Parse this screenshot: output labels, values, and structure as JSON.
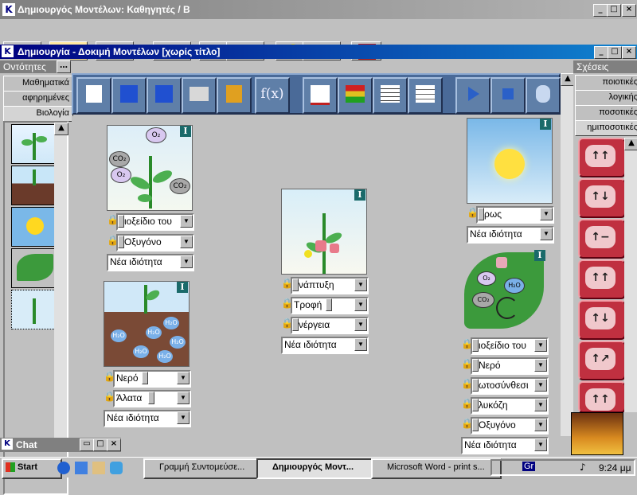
{
  "app": {
    "title": "Δημιουργός Μοντέλων:  Καθηγητές  /  Β"
  },
  "model_window": {
    "title": "Δημιουργία - Δοκιμή Μοντέλων [χωρίς τίτλο]"
  },
  "entities_panel": {
    "title": "Οντότητες",
    "tabs": [
      "Μαθηματικά",
      "αφηρημένες",
      "Βιολογία"
    ]
  },
  "relations_panel": {
    "title": "Σχέσεις",
    "tabs": [
      "ποιοτικές",
      "λογικής",
      "ποσοτικές",
      "ημιποσοτικές"
    ],
    "buttons": [
      "↑↑",
      "↑↓",
      "↑−",
      "↑↑",
      "↑↓",
      "↑↗",
      "↑↑"
    ]
  },
  "toolbar": {
    "fx_label": "f(x)"
  },
  "cards": {
    "plant_air": {
      "badge": "I",
      "props": [
        "ιοξείδιο του",
        "Οξυγόνο"
      ],
      "new": "Νέα ιδιότητα",
      "labels": [
        "O₂",
        "CO₂",
        "O₂",
        "CO₂"
      ]
    },
    "plant_soil": {
      "badge": "I",
      "props": [
        "Νερό",
        "Άλατα"
      ],
      "new": "Νέα ιδιότητα",
      "labels": [
        "H₂O",
        "H₂O",
        "H₂O",
        "H₂O",
        "H₂O",
        "H₂O"
      ]
    },
    "plant_flower": {
      "badge": "I",
      "props": [
        "νάπτυξη",
        "Τροφή",
        "νέργεια"
      ],
      "new": "Νέα ιδιότητα"
    },
    "sun": {
      "badge": "I",
      "props": [
        "ρως"
      ],
      "new": "Νέα ιδιότητα"
    },
    "leaf": {
      "badge": "I",
      "props": [
        "ιοξείδιο του",
        "Νερό",
        "ωτοσύνθεσι",
        "λυκόζη",
        "Οξυγόνο"
      ],
      "new": "Νέα ιδιότητα",
      "labels": [
        "O₂",
        "H₂O",
        "CO₂"
      ]
    }
  },
  "chat": {
    "title": "Chat"
  },
  "taskbar": {
    "start": "Start",
    "tasks": [
      "Γραμμή Συντομεύσε...",
      "Δημιουργός Μοντ...",
      "Microsoft Word - print s..."
    ],
    "lang": "Gr",
    "clock": "9:24 μμ"
  }
}
